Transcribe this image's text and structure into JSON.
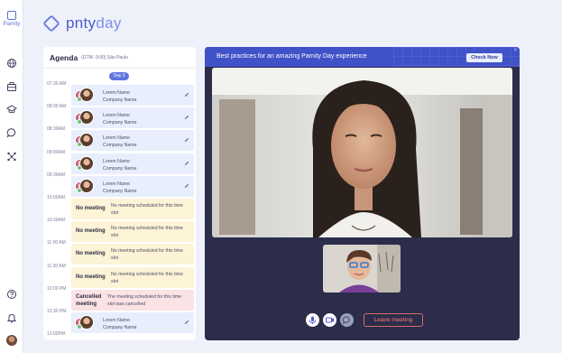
{
  "rail": {
    "logo_text": "Parnity",
    "icons": [
      "globe-icon",
      "briefcase-icon",
      "graduation-cap-icon",
      "chat-icon",
      "network-icon",
      "help-icon",
      "bell-icon"
    ]
  },
  "brand": {
    "name_left": "pnty",
    "name_right": "day"
  },
  "agenda": {
    "title": "Agenda",
    "timezone": "(GTM -3:00) São Paulo",
    "day_label": "Day 3",
    "times": [
      "07:30 AM",
      "08:00 AM",
      "08:30AM",
      "09:00AM",
      "09:30AM",
      "10:00AM",
      "10:30AM",
      "11:00 AM",
      "11:30 AM",
      "12:00 PM",
      "12:30 PM",
      "13:00PM"
    ],
    "slots": [
      {
        "type": "meeting",
        "name": "Lorem Name",
        "company": "Company Name"
      },
      {
        "type": "meeting",
        "name": "Lorem Name",
        "company": "Company Name"
      },
      {
        "type": "meeting",
        "name": "Lorem Name",
        "company": "Company Name"
      },
      {
        "type": "meeting",
        "name": "Lorem Name",
        "company": "Company Name"
      },
      {
        "type": "meeting",
        "name": "Lorem Name",
        "company": "Company Name"
      },
      {
        "type": "empty",
        "label": "No meeting",
        "desc": "No meeting scheduled for this time slot"
      },
      {
        "type": "empty",
        "label": "No meeting",
        "desc": "No meeting scheduled for this time slot"
      },
      {
        "type": "empty",
        "label": "No meeting",
        "desc": "No meeting scheduled for this time slot"
      },
      {
        "type": "empty",
        "label": "No meeting",
        "desc": "No meeting scheduled for this time slot"
      },
      {
        "type": "cancel",
        "label": "Cancelled meeting",
        "desc": "The meeting scheduled for this time slot was cancelled"
      },
      {
        "type": "meeting",
        "name": "Lorem Name",
        "company": "Company Name"
      }
    ]
  },
  "video": {
    "banner_text": "Best practices for an amazing Parnity Day experience",
    "banner_button": "Check Now",
    "banner_close": "×",
    "leave_label": "Leave meeting",
    "controls": [
      "microphone-icon",
      "camera-icon",
      "chat-icon"
    ]
  },
  "colors": {
    "accent": "#5f74e0",
    "banner": "#4052c8",
    "video_bg": "#2b2d4a",
    "meeting_bg": "#e8eefc",
    "empty_bg": "#fdf3d6",
    "cancel_bg": "#fbe2e4",
    "leave_red": "#ff7a7a"
  }
}
